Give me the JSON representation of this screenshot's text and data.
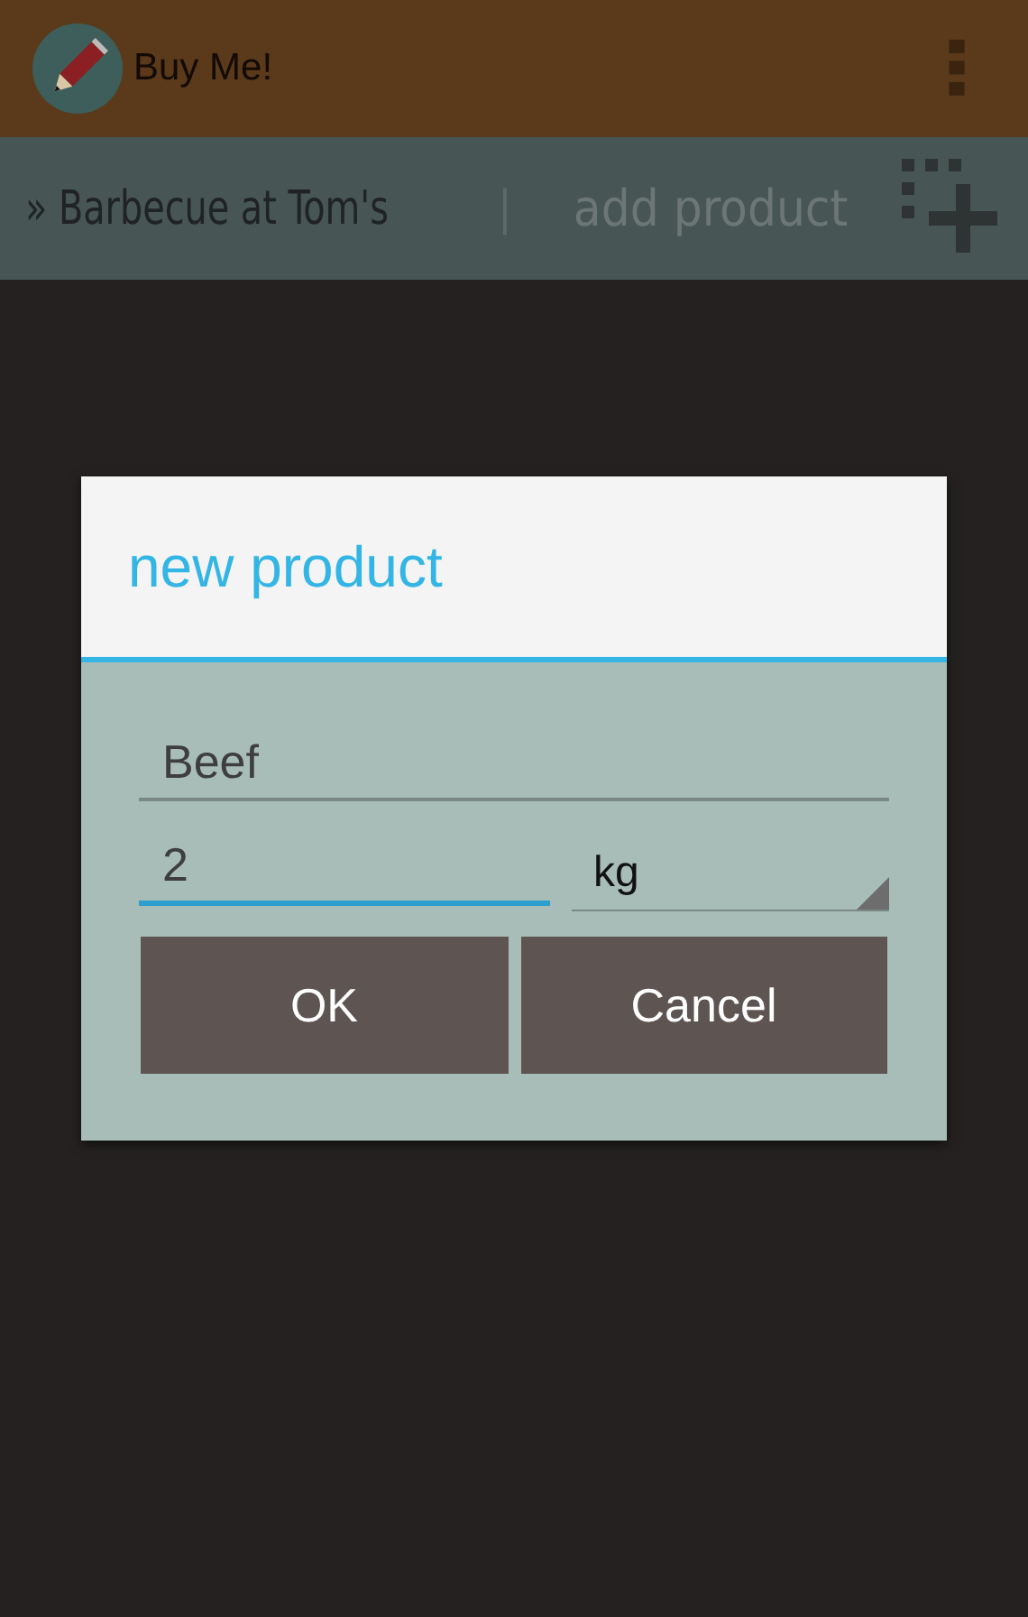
{
  "app_bar": {
    "title": "Buy Me!"
  },
  "list_bar": {
    "list_name": "» Barbecue at Tom's",
    "separator": "|",
    "action": "add product"
  },
  "dialog": {
    "title": "new product",
    "fields": [
      {
        "value": "Beef",
        "focused": false
      },
      {
        "value": "2",
        "focused": true
      }
    ],
    "unit": {
      "value": "kg"
    },
    "buttons": [
      "OK",
      "Cancel"
    ]
  }
}
